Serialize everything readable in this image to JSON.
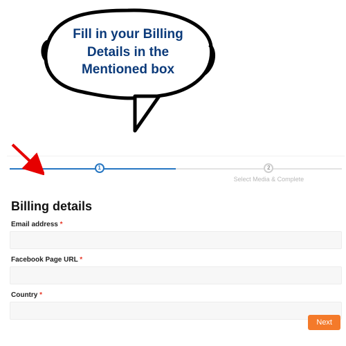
{
  "callout": {
    "line1": "Fill in your Billing",
    "line2": "Details in the",
    "line3": "Mentioned box"
  },
  "stepper": {
    "step1_number": "1",
    "step2_number": "2",
    "step2_caption": "Select Media & Complete"
  },
  "form": {
    "section_title": "Billing details",
    "email_label": "Email address",
    "email_value": "",
    "fb_label": "Facebook Page URL",
    "fb_value": "",
    "country_label": "Country",
    "country_value": "",
    "required_mark": "*"
  },
  "actions": {
    "next_label": "Next"
  }
}
